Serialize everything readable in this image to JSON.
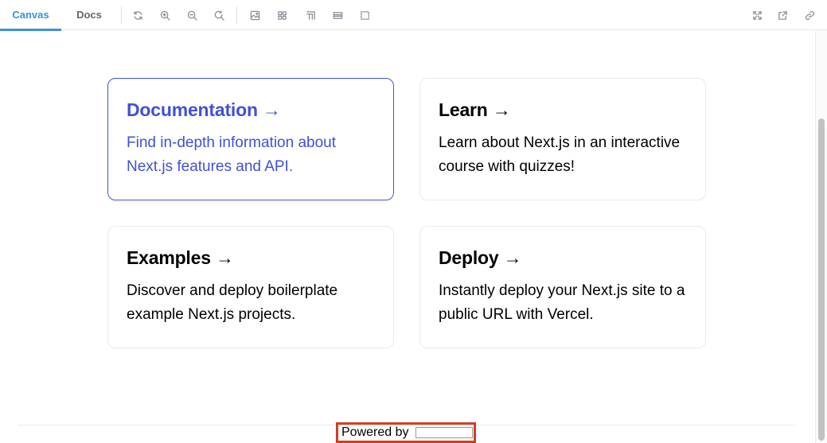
{
  "toolbar": {
    "tabs": [
      {
        "label": "Canvas",
        "active": true
      },
      {
        "label": "Docs",
        "active": false
      }
    ],
    "tools": [
      "reload-icon",
      "zoom-in-icon",
      "zoom-out-icon",
      "reset-zoom-icon",
      "background-icon",
      "grid-icon",
      "measure-icon",
      "viewport-icon",
      "outline-icon"
    ],
    "right_tools": [
      "fullscreen-icon",
      "open-new-tab-icon",
      "copy-link-icon"
    ],
    "accent_color": "#3d90d8"
  },
  "cards": [
    {
      "title": "Documentation →",
      "description": "Find in-depth information about Next.js features and API."
    },
    {
      "title": "Learn →",
      "description": "Learn about Next.js in an interactive course with quizzes!"
    },
    {
      "title": "Examples →",
      "description": "Discover and deploy boilerplate example Next.js projects."
    },
    {
      "title": "Deploy →",
      "description": "Instantly deploy your Next.js site to a public URL with Vercel."
    }
  ],
  "active_card_color": "#3f51d8",
  "footer": {
    "powered_by": "Powered by"
  }
}
